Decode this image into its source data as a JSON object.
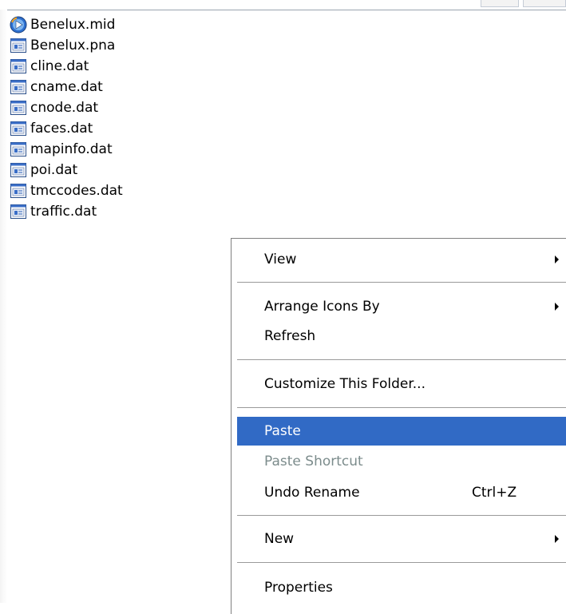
{
  "files": [
    {
      "name": "Benelux.mid",
      "icon": "media-player-icon"
    },
    {
      "name": "Benelux.pna",
      "icon": "generic-file-icon"
    },
    {
      "name": "cline.dat",
      "icon": "generic-file-icon"
    },
    {
      "name": "cname.dat",
      "icon": "generic-file-icon"
    },
    {
      "name": "cnode.dat",
      "icon": "generic-file-icon"
    },
    {
      "name": "faces.dat",
      "icon": "generic-file-icon"
    },
    {
      "name": "mapinfo.dat",
      "icon": "generic-file-icon"
    },
    {
      "name": "poi.dat",
      "icon": "generic-file-icon"
    },
    {
      "name": "tmccodes.dat",
      "icon": "generic-file-icon"
    },
    {
      "name": "traffic.dat",
      "icon": "generic-file-icon"
    }
  ],
  "context_menu": {
    "view": {
      "label": "View",
      "submenu": true
    },
    "arrange_icons_by": {
      "label": "Arrange Icons By",
      "submenu": true
    },
    "refresh": {
      "label": "Refresh"
    },
    "customize_folder": {
      "label": "Customize This Folder..."
    },
    "paste": {
      "label": "Paste",
      "state": "highlighted"
    },
    "paste_shortcut": {
      "label": "Paste Shortcut",
      "state": "disabled"
    },
    "undo_rename": {
      "label": "Undo Rename",
      "shortcut": "Ctrl+Z"
    },
    "new": {
      "label": "New",
      "submenu": true
    },
    "properties": {
      "label": "Properties"
    }
  },
  "colors": {
    "highlight": "#316ac5",
    "disabled_text": "#7c8c8c",
    "separator": "#9a9a9a"
  }
}
